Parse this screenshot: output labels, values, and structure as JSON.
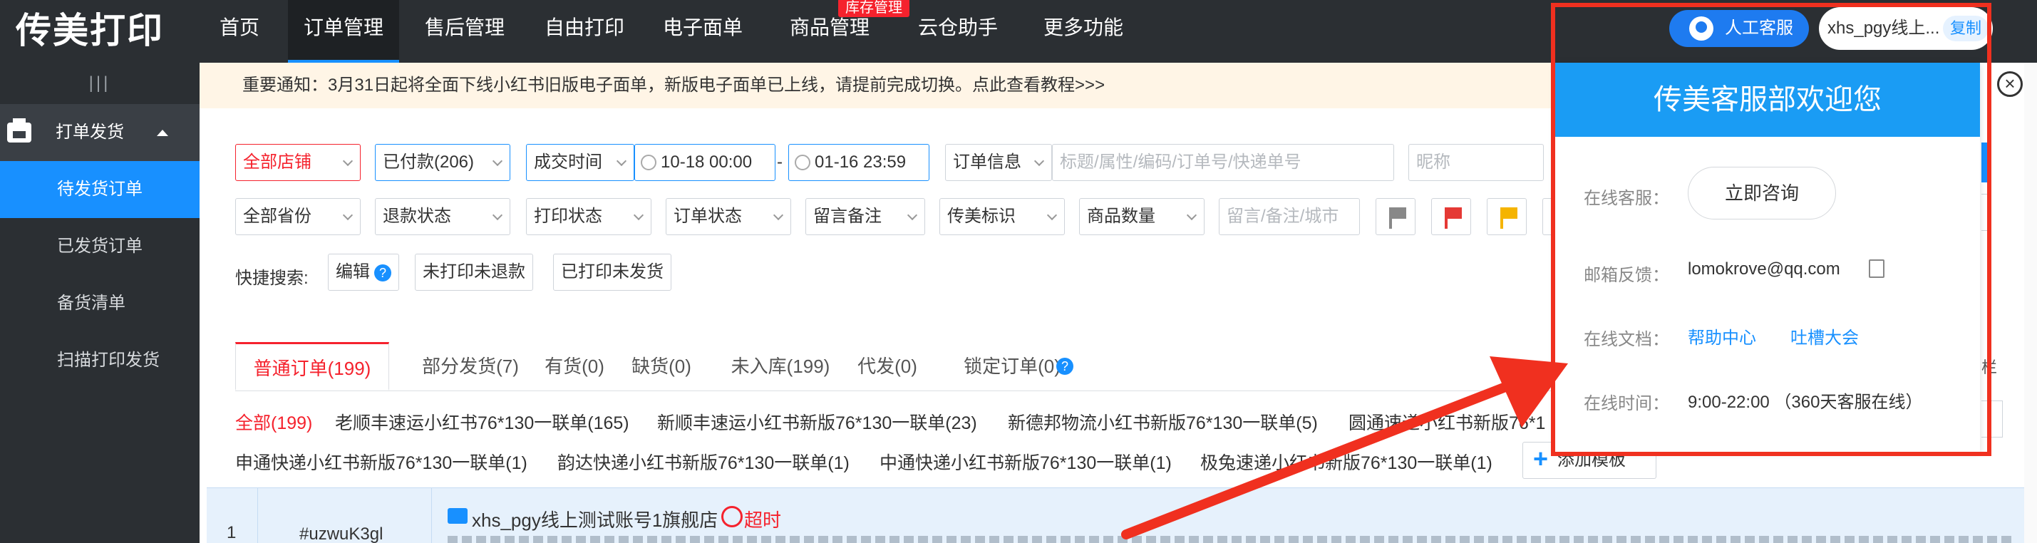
{
  "logo": "传美打印",
  "nav": {
    "items": [
      "首页",
      "订单管理",
      "售后管理",
      "自由打印",
      "电子面单",
      "商品管理",
      "云仓助手",
      "更多功能"
    ],
    "badge": "库存管理",
    "cs_button": "人工客服",
    "account": "xhs_pgy线上...",
    "copy": "复制"
  },
  "sidebar": {
    "handle": "|||",
    "group": "打单发货",
    "items": [
      "待发货订单",
      "已发货订单",
      "备货清单",
      "扫描打印发货"
    ]
  },
  "notice": "重要通知：3月31日起将全面下线小红书旧版电子面单，新版电子面单已上线，请提前完成切换。点此查看教程>>>",
  "filters": {
    "shop": "全部店铺",
    "paid": "已付款(206)",
    "time_type": "成交时间",
    "start": "10-18 00:00",
    "sep": "-",
    "end": "01-16 23:59",
    "order_info": "订单信息",
    "search_placeholder": "标题/属性/编码/订单号/快递单号",
    "nickname_placeholder": "昵称",
    "province": "全部省份",
    "refund": "退款状态",
    "print": "打印状态",
    "order_status": "订单状态",
    "remark": "留言备注",
    "cm_mark": "传美标识",
    "qty": "商品数量",
    "remark_placeholder": "留言/备注/城市",
    "flag_colors": [
      "#888888",
      "#e53935",
      "#f5b400"
    ]
  },
  "quick": {
    "label": "快捷搜索:",
    "edit": "编辑",
    "help": "?",
    "b1": "未打印未退款",
    "b2": "已打印未发货"
  },
  "tabs": [
    "普通订单(199)",
    "部分发货(7)",
    "有货(0)",
    "缺货(0)",
    "未入库(199)",
    "代发(0)",
    "锁定订单(0)"
  ],
  "templates": {
    "row1": [
      "全部(199)",
      "老顺丰速运小红书76*130一联单(165)",
      "新顺丰速运小红书新版76*130一联单(23)",
      "新德邦物流小红书新版76*130一联单(5)",
      "圆通速递小红书新版76*1"
    ],
    "row2": [
      "申通快递小红书新版76*130一联单(1)",
      "韵达快递小红书新版76*130一联单(1)",
      "中通快递小红书新版76*130一联单(1)",
      "极兔速递小红书新版76*130一联单(1)"
    ],
    "add": "添加模板"
  },
  "order": {
    "index": "1",
    "id": "#uzwuK3gl",
    "shop": "xhs_pgy线上测试账号1旗舰店",
    "overtime": "超时"
  },
  "popup": {
    "title": "传美客服部欢迎您",
    "online_cs_label": "在线客服：",
    "consult": "立即咨询",
    "email_label": "邮箱反馈：",
    "email": "lomokrove@qq.com",
    "docs_label": "在线文档：",
    "help": "帮助中心",
    "feedback": "吐槽大会",
    "hours_label": "在线时间：",
    "hours": "9:00-22:00 （360天客服在线）"
  },
  "edge_text": "栏",
  "colors": {
    "accent": "#1890ff",
    "highlight": "#f0301f",
    "header": "#1a9cf4"
  }
}
